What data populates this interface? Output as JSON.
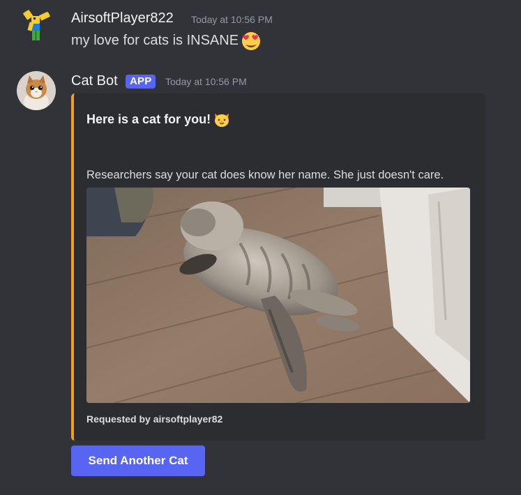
{
  "messages": [
    {
      "username": "AirsoftPlayer822",
      "timestamp": "Today at 10:56 PM",
      "text": "my love for cats is INSANE",
      "emoji": "heart-eyes-emoji"
    },
    {
      "username": "Cat Bot",
      "badge": "APP",
      "timestamp": "Today at 10:56 PM",
      "embed": {
        "accent_color": "#f0a020",
        "title": "Here is a cat for you!",
        "title_emoji": "cat-face-emoji",
        "description": "Researchers say your cat does know her name. She just doesn't care.",
        "image_alt": "fluffy gray tabby cat lying on wooden floor",
        "footer": "Requested by airsoftplayer82"
      },
      "button_label": "Send Another Cat"
    }
  ],
  "colors": {
    "background": "#313338",
    "embed_bg": "#2b2d31",
    "blurple": "#5865f2",
    "timestamp": "#949ba4"
  }
}
